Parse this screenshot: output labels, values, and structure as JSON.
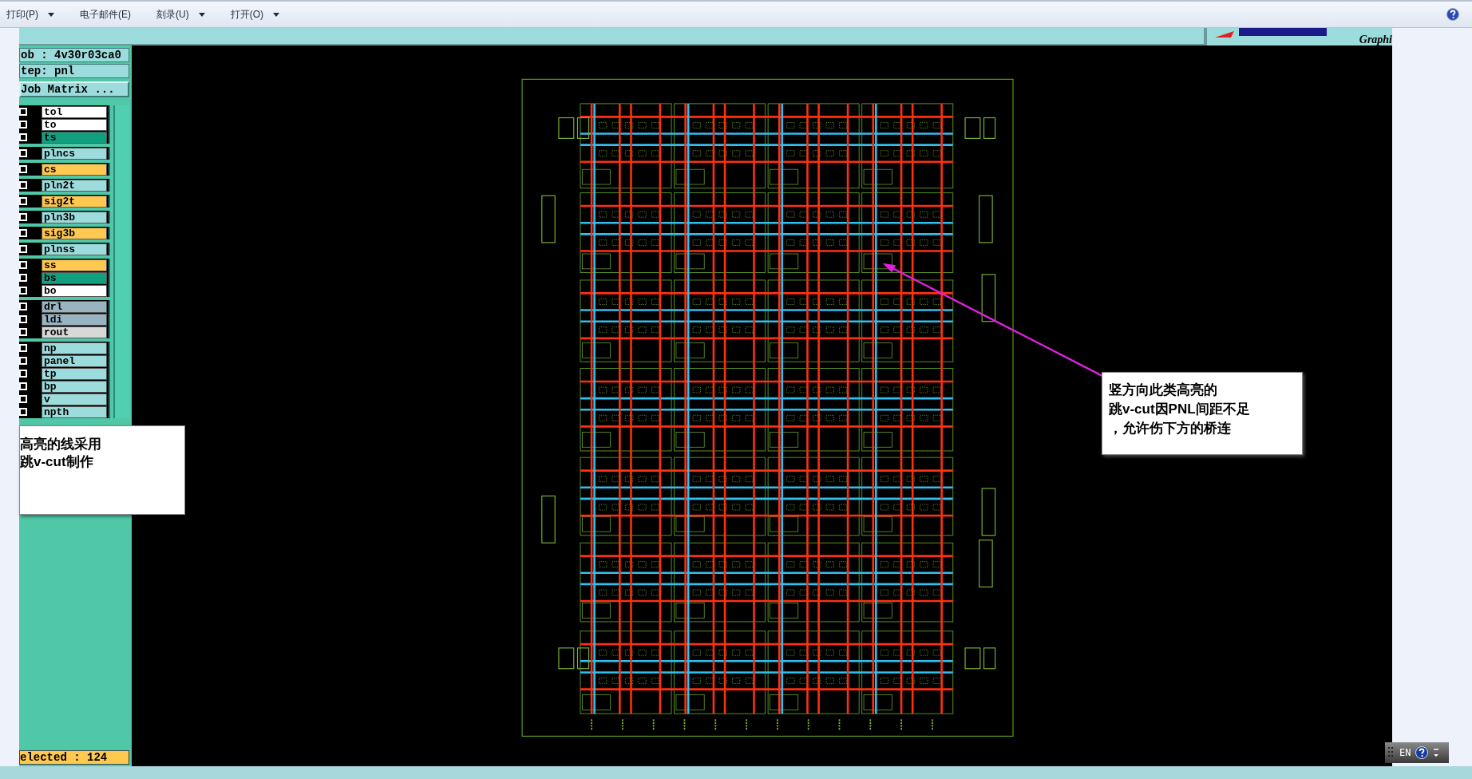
{
  "toolbar": {
    "items": [
      {
        "label": "打印(P)",
        "dropdown": true
      },
      {
        "label": "电子邮件(E)",
        "dropdown": false
      },
      {
        "label": "刻录(U)",
        "dropdown": true
      },
      {
        "label": "打开(O)",
        "dropdown": true
      }
    ]
  },
  "logo": {
    "text": "Graphi"
  },
  "job_panel": {
    "job": "ob : 4v30r03ca0",
    "step": "tep: pnl",
    "matrix_button": "Job Matrix ...",
    "layer_groups": [
      {
        "layers": [
          {
            "name": "tol",
            "color": "#ffffff",
            "checked": false
          },
          {
            "name": "to",
            "color": "#ffffff",
            "checked": false
          },
          {
            "name": "ts",
            "color": "#10a080",
            "checked": false
          }
        ]
      },
      {
        "layers": [
          {
            "name": "plncs",
            "color": "#9ddcdc",
            "checked": false
          }
        ]
      },
      {
        "layers": [
          {
            "name": "cs",
            "color": "#ffc850",
            "checked": false
          }
        ]
      },
      {
        "layers": [
          {
            "name": "pln2t",
            "color": "#9ddcdc",
            "checked": false
          }
        ]
      },
      {
        "layers": [
          {
            "name": "sig2t",
            "color": "#ffc850",
            "checked": false
          }
        ]
      },
      {
        "layers": [
          {
            "name": "pln3b",
            "color": "#9ddcdc",
            "checked": false
          }
        ]
      },
      {
        "layers": [
          {
            "name": "sig3b",
            "color": "#ffc850",
            "checked": false
          }
        ]
      },
      {
        "layers": [
          {
            "name": "plnss",
            "color": "#9ddcdc",
            "checked": false
          }
        ]
      },
      {
        "layers": [
          {
            "name": "ss",
            "color": "#ffc850",
            "checked": false
          },
          {
            "name": "bs",
            "color": "#10a080",
            "checked": false
          },
          {
            "name": "bo",
            "color": "#ffffff",
            "checked": false
          }
        ]
      },
      {
        "layers": [
          {
            "name": "drl",
            "color": "#98b4c0",
            "checked": false
          },
          {
            "name": "ldi",
            "color": "#98b4c0",
            "checked": false
          },
          {
            "name": "rout",
            "color": "#d8d8d8",
            "checked": false
          }
        ]
      },
      {
        "layers": [
          {
            "name": "np",
            "color": "#9ddcdc",
            "checked": false
          },
          {
            "name": "panel",
            "color": "#9ddcdc",
            "checked": false
          },
          {
            "name": "tp",
            "color": "#9ddcdc",
            "checked": false
          },
          {
            "name": "bp",
            "color": "#9ddcdc",
            "checked": false
          },
          {
            "name": "v",
            "color": "#9ddcdc",
            "checked": false
          },
          {
            "name": "npth",
            "color": "#9ddcdc",
            "checked": false
          }
        ]
      }
    ],
    "selected_count": "elected : 124"
  },
  "annotations": [
    {
      "lines": [
        "竖方向此类高亮的",
        "跳v-cut因PNL间距不足",
        "，允许伤下方的桥连"
      ]
    },
    {
      "lines": [
        "高亮的线采用",
        "跳v-cut制作"
      ]
    }
  ],
  "language_bar": {
    "label": "EN"
  }
}
